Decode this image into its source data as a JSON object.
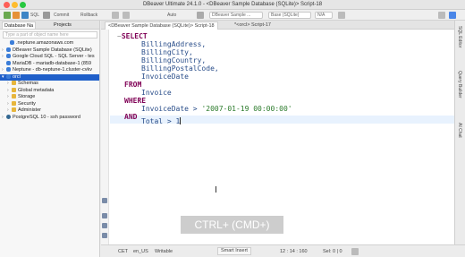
{
  "window": {
    "title": "DBeaver Ultimate 24.1.0 - <DBeaver Sample Database (SQLite)> Script-18"
  },
  "toolbar": {
    "sql_label": "SQL",
    "commit_label": "Commit",
    "rollback_label": "Rollback",
    "auto_label": "Auto",
    "datasource_value": "DBeaver Sample ...",
    "schema_value": "Base (SQLite)",
    "n_a_value": "N/A"
  },
  "left_panel": {
    "tabs": [
      "Database Na",
      "Projects"
    ],
    "filter_placeholder": "Type a part of object name here",
    "tree": [
      {
        "label": ".neptune.amazonaws.com",
        "icon": "db",
        "caret": "",
        "selected": false
      },
      {
        "label": "DBeaver Sample Database (SQLite)",
        "icon": "db",
        "caret": ">",
        "selected": false
      },
      {
        "label": "Google Cloud SQL - SQL Server - tes",
        "icon": "db",
        "caret": ">",
        "selected": false
      },
      {
        "label": "MariaDB - mariadb-database-1 (859",
        "icon": "db",
        "caret": "",
        "selected": false
      },
      {
        "label": "Neptune - db-neptune-1.cluster-cvkv",
        "icon": "db",
        "caret": ">",
        "selected": false
      },
      {
        "label": "orcl",
        "icon": "db",
        "caret": "v",
        "selected": true
      },
      {
        "label": "Schemas",
        "icon": "folder",
        "caret": ">",
        "selected": false
      },
      {
        "label": "Global metadata",
        "icon": "folder",
        "caret": ">",
        "selected": false
      },
      {
        "label": "Storage",
        "icon": "folder",
        "caret": ">",
        "selected": false
      },
      {
        "label": "Security",
        "icon": "folder",
        "caret": ">",
        "selected": false
      },
      {
        "label": "Administer",
        "icon": "folder",
        "caret": ">",
        "selected": false
      },
      {
        "label": "PostgreSQL 10 - ssh password",
        "icon": "pg",
        "caret": ">",
        "selected": false
      }
    ]
  },
  "editor": {
    "tabs": [
      {
        "label": "<DBeaver Sample Database (SQLite)> Script-18",
        "active": true
      },
      {
        "label": "*<orcl> Script-17",
        "active": false
      }
    ],
    "code": {
      "select": "SELECT",
      "columns": [
        "BillingAddress,",
        "BillingCity,",
        "BillingCountry,",
        "BillingPostalCode,",
        "InvoiceDate"
      ],
      "from": "FROM",
      "table": "Invoice",
      "where": "WHERE",
      "where_col": "InvoiceDate > ",
      "where_val": "'2007-01-19 00:00:00'",
      "and": "AND",
      "and_expr": "Total > 1"
    },
    "overlay_text": "CTRL+ (CMD+)"
  },
  "right_panel": {
    "tabs": [
      "SQL Editor",
      "Query Builder",
      "AI Chat"
    ]
  },
  "status_bar": {
    "timezone": "CET",
    "locale": "en_US",
    "mode": "Writable",
    "insert_mode": "Smart Insert",
    "position": "12 : 14 : 160",
    "selection": "Sel: 0 | 0"
  }
}
